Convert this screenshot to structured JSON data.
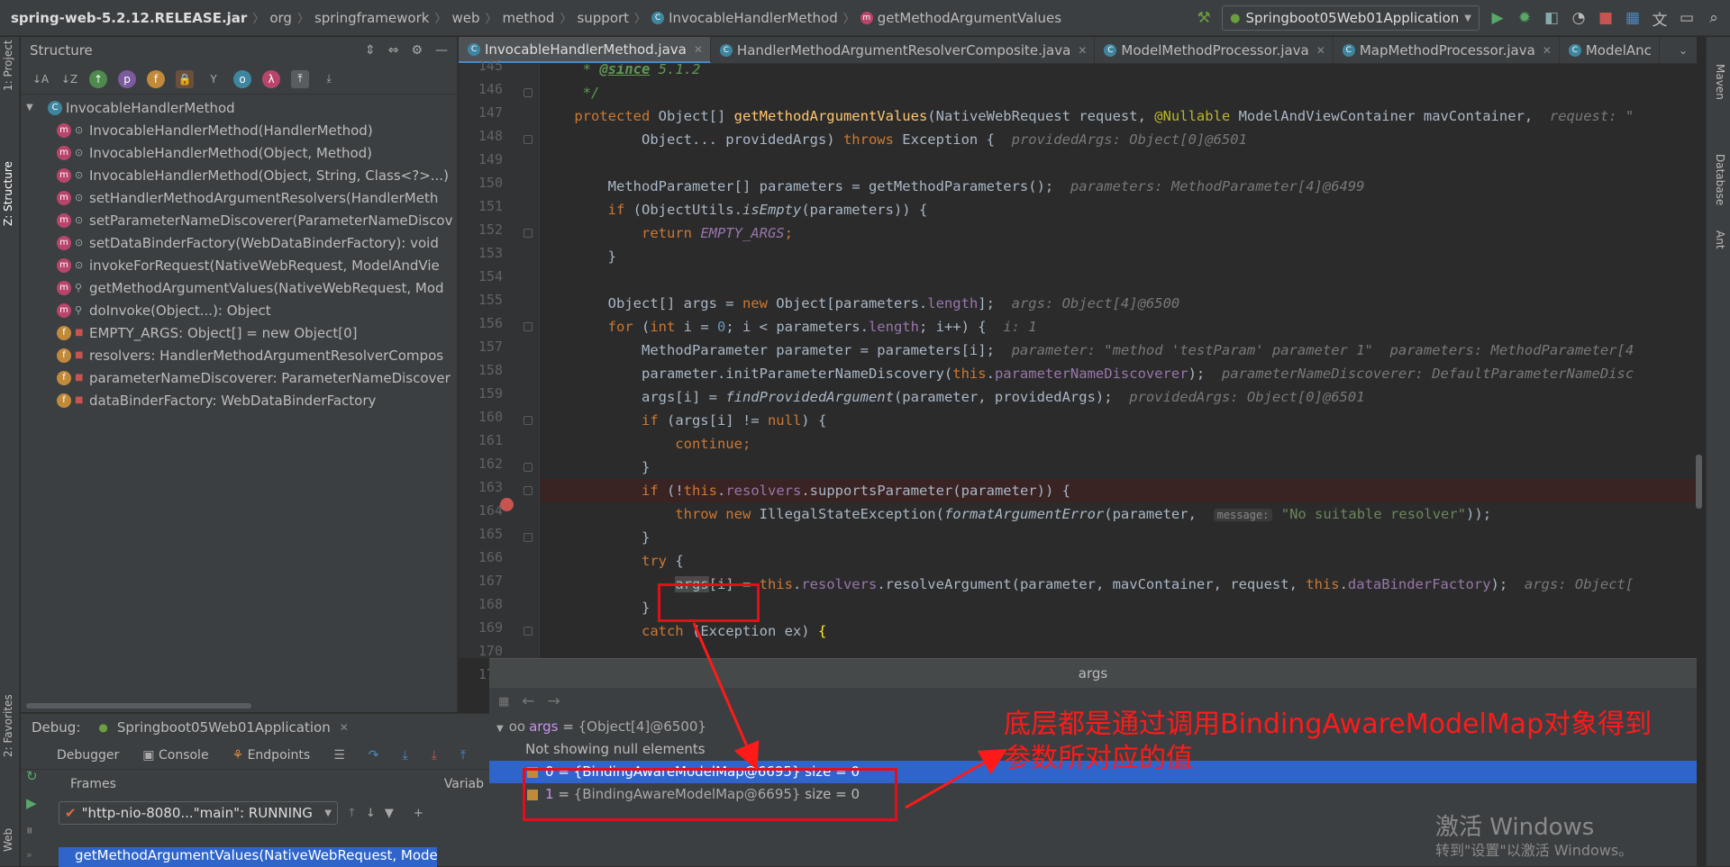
{
  "navbar": {
    "crumbs": [
      "spring-web-5.2.12.RELEASE.jar",
      "org",
      "springframework",
      "web",
      "method",
      "support",
      "InvocableHandlerMethod",
      "getMethodArgumentValues"
    ],
    "run_config": "Springboot05Web01Application"
  },
  "left_strip": {
    "project": "1: Project",
    "structure": "Z: Structure",
    "favorites": "2: Favorites",
    "web": "Web"
  },
  "right_strip": {
    "maven": "Maven",
    "database": "Database",
    "ant": "Ant"
  },
  "structure": {
    "title": "Structure",
    "root": "InvocableHandlerMethod",
    "items": [
      {
        "kind": "m",
        "label": "InvocableHandlerMethod(HandlerMethod)"
      },
      {
        "kind": "m",
        "label": "InvocableHandlerMethod(Object, Method)"
      },
      {
        "kind": "m",
        "label": "InvocableHandlerMethod(Object, String, Class<?>...)"
      },
      {
        "kind": "m",
        "label": "setHandlerMethodArgumentResolvers(HandlerMeth"
      },
      {
        "kind": "m",
        "label": "setParameterNameDiscoverer(ParameterNameDiscov"
      },
      {
        "kind": "m",
        "label": "setDataBinderFactory(WebDataBinderFactory): void"
      },
      {
        "kind": "m",
        "label": "invokeForRequest(NativeWebRequest, ModelAndVie"
      },
      {
        "kind": "m",
        "label": "getMethodArgumentValues(NativeWebRequest, Mod"
      },
      {
        "kind": "m",
        "label": "doInvoke(Object...): Object"
      },
      {
        "kind": "f",
        "label": "EMPTY_ARGS: Object[] = new Object[0]"
      },
      {
        "kind": "f",
        "label": "resolvers: HandlerMethodArgumentResolverCompos"
      },
      {
        "kind": "f",
        "label": "parameterNameDiscoverer: ParameterNameDiscover"
      },
      {
        "kind": "f",
        "label": "dataBinderFactory: WebDataBinderFactory"
      }
    ]
  },
  "editor": {
    "tabs": [
      {
        "label": "InvocableHandlerMethod.java",
        "active": true
      },
      {
        "label": "HandlerMethodArgumentResolverComposite.java",
        "active": false
      },
      {
        "label": "ModelMethodProcessor.java",
        "active": false
      },
      {
        "label": "MapMethodProcessor.java",
        "active": false
      },
      {
        "label": "ModelAnc",
        "active": false
      }
    ],
    "line_numbers": [
      "145",
      "146",
      "147",
      "148",
      "149",
      "150",
      "151",
      "152",
      "153",
      "154",
      "155",
      "156",
      "157",
      "158",
      "159",
      "160",
      "161",
      "162",
      "163",
      "164",
      "165",
      "166",
      "167",
      "168",
      "169",
      "170",
      "171"
    ],
    "hints": {
      "l147": "request: \"",
      "l148": "providedArgs: Object[0]@6501",
      "l150": "parameters: MethodParameter[4]@6499",
      "l155": "args: Object[4]@6500",
      "l156": "i: 1",
      "l157a": "parameter: \"method 'testParam' parameter 1\"",
      "l157b": "parameters: MethodParameter[4",
      "l158": "parameterNameDiscoverer: DefaultParameterNameDisc",
      "l159": "providedArgs: Object[0]@6501",
      "l164_param": "message:",
      "l167": "args: Object["
    },
    "strings": {
      "since": "5.1.2",
      "no_resolver": "\"No suitable resolver\""
    }
  },
  "debug": {
    "label": "Debug:",
    "session": "Springboot05Web01Application",
    "tabs": [
      "Debugger",
      "Console",
      "Endpoints"
    ],
    "frames_label": "Frames",
    "variables_label": "Variab",
    "thread": "\"http-nio-8080...\"main\": RUNNING",
    "frame": "getMethodArgumentValues(NativeWebRequest, Mode"
  },
  "popup": {
    "title": "args",
    "root_name": "args",
    "root_value": "{Object[4]@6500}",
    "note": "Not showing null elements",
    "rows": [
      {
        "name": "0",
        "value": "{BindingAwareModelMap@6695}",
        "size": "size = 0",
        "selected": true
      },
      {
        "name": "1",
        "value": "{BindingAwareModelMap@6695}",
        "size": "size = 0",
        "selected": false
      }
    ]
  },
  "annotation": {
    "line1": "底层都是通过调用BindingAwareModelMap对象得到",
    "line2": "参数所对应的值",
    "color": "#ff1a1a"
  },
  "watermark": {
    "line1": "激活 Windows",
    "line2": "转到\"设置\"以激活 Windows。"
  },
  "colors": {
    "keyword": "#cc7832",
    "method": "#ffc66d",
    "field": "#9876aa",
    "string": "#6a8759",
    "selection": "#2f65ca"
  }
}
